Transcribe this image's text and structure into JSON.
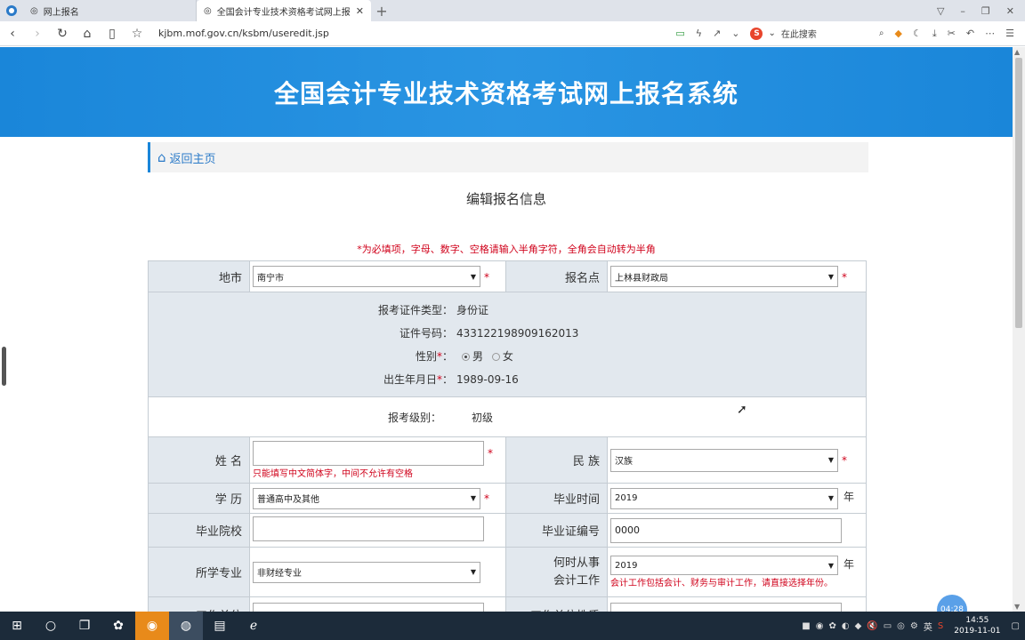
{
  "browser": {
    "tabs": [
      {
        "label": "网上报名",
        "active": false
      },
      {
        "label": "全国会计专业技术资格考试网上报名",
        "active": true
      }
    ],
    "url": "kjbm.mof.gov.cn/ksbm/useredit.jsp",
    "search_placeholder": "在此搜索"
  },
  "header": {
    "banner_title": "全国会计专业技术资格考试网上报名系统",
    "banner_color": "#1a86d9",
    "breadcrumb": "返回主页"
  },
  "page": {
    "title": "编辑报名信息",
    "notice": "*为必填项，字母、数字、空格请输入半角字符，全角会自动转为半角"
  },
  "form": {
    "city": {
      "label": "地市",
      "value": "南宁市"
    },
    "site": {
      "label": "报名点",
      "value": "上林县财政局"
    },
    "id_type": {
      "label": "报考证件类型：",
      "value": "身份证"
    },
    "id_number": {
      "label": "证件号码：",
      "value": "433122198909162013"
    },
    "gender": {
      "label": "性别",
      "options": [
        "男",
        "女"
      ],
      "selected": "男"
    },
    "birthdate": {
      "label": "出生年月日",
      "value": "1989-09-16"
    },
    "level": {
      "label": "报考级别：",
      "value": "初级"
    },
    "name": {
      "label": "姓 名",
      "value": "",
      "hint": "只能填写中文简体字，中间不允许有空格"
    },
    "ethnicity": {
      "label": "民 族",
      "value": "汉族"
    },
    "education": {
      "label": "学 历",
      "value": "普通高中及其他"
    },
    "grad_time": {
      "label": "毕业时间",
      "value": "2019",
      "unit": "年"
    },
    "school": {
      "label": "毕业院校",
      "value": ""
    },
    "cert_no": {
      "label": "毕业证编号",
      "value": "0000"
    },
    "major": {
      "label": "所学专业",
      "value": "非财经专业"
    },
    "work_start": {
      "label_1": "何时从事",
      "label_2": "会计工作",
      "value": "2019",
      "unit": "年",
      "hint": "会计工作包括会计、财务与审计工作，请直接选择年份。"
    },
    "row_partial": {
      "label_left": "工作单位",
      "label_right": "工作单位性质"
    }
  },
  "overlay": {
    "timer": "04:28"
  },
  "taskbar": {
    "time": "14:55",
    "date": "2019-11-01",
    "ime": "英"
  }
}
